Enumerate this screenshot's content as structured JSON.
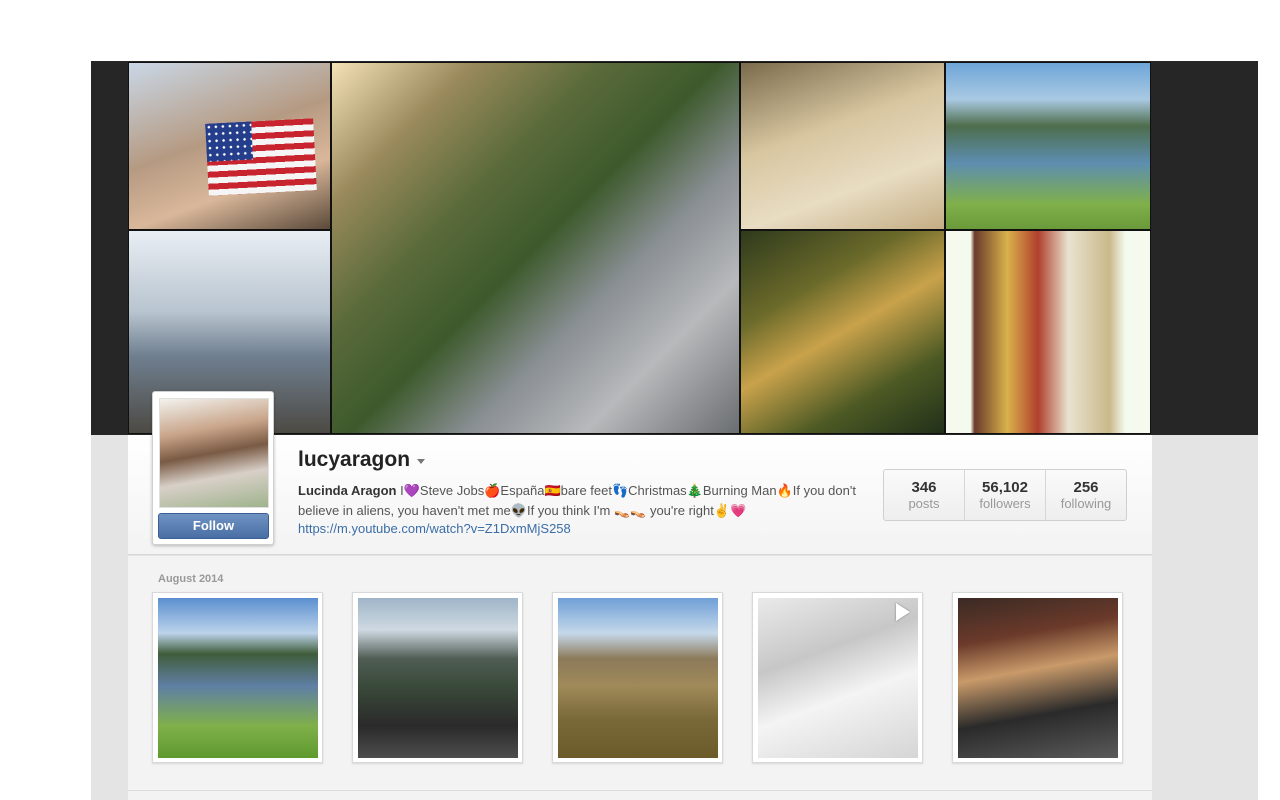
{
  "profile": {
    "username": "lucyaragon",
    "full_name": "Lucinda Aragon",
    "bio": "I💜Steve Jobs🍎España🇪🇸bare feet👣Christmas🎄Burning Man🔥If you don't believe in aliens, you haven't met me👽If you think I'm 👡👡 you're right✌️💗",
    "link": "https://m.youtube.com/watch?v=Z1DxmMjS258",
    "follow_label": "Follow"
  },
  "stats": [
    {
      "value": "346",
      "label": "posts"
    },
    {
      "value": "56,102",
      "label": "followers"
    },
    {
      "value": "256",
      "label": "following"
    }
  ],
  "feed": {
    "month_label": "August 2014"
  },
  "colors": {
    "follow_button": "#4a6fa5",
    "link": "#3b6ea8",
    "header_band": "#262626"
  }
}
